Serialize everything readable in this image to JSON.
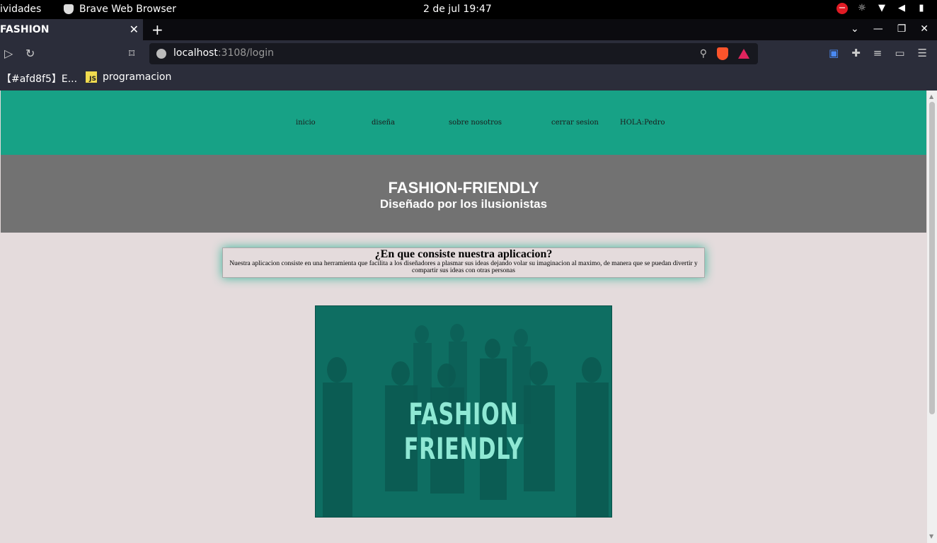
{
  "system_bar": {
    "activities": "ividades",
    "app_name": "Brave Web Browser",
    "clock": "2 de jul  19:47"
  },
  "browser": {
    "tab_title": "FASHION",
    "tab_close": "✕",
    "new_tab": "+",
    "url_host": "localhost",
    "url_path": ":3108/login",
    "bookmarks": [
      {
        "label": "【#afd8f5】E..."
      },
      {
        "label": "programacion",
        "icon": "js-icon"
      }
    ]
  },
  "site": {
    "nav": {
      "inicio": "inicio",
      "disena": "diseña",
      "sobre": "sobre nosotros",
      "cerrar": "cerrar sesion",
      "hola": "HOLA:Pedro"
    },
    "hero_title": "FASHION-FRIENDLY",
    "hero_subtitle": "Diseñado por los ilusionistas",
    "info_title": "¿En que consiste nuestra aplicacion?",
    "info_text": "Nuestra aplicacion consiste en una herramienta que facilita a los diseñadores a plasmar sus ideas dejando volar su imaginacion al maximo, de manera que se puedan divertir y compartir sus ideas con otras personas",
    "poster_text": "FASHION FRIENDLY"
  },
  "colors": {
    "nav_bg": "#17a286",
    "hero_bg": "#727272",
    "page_bg": "#e4dbdc",
    "poster_bg": "#0e6e62"
  }
}
